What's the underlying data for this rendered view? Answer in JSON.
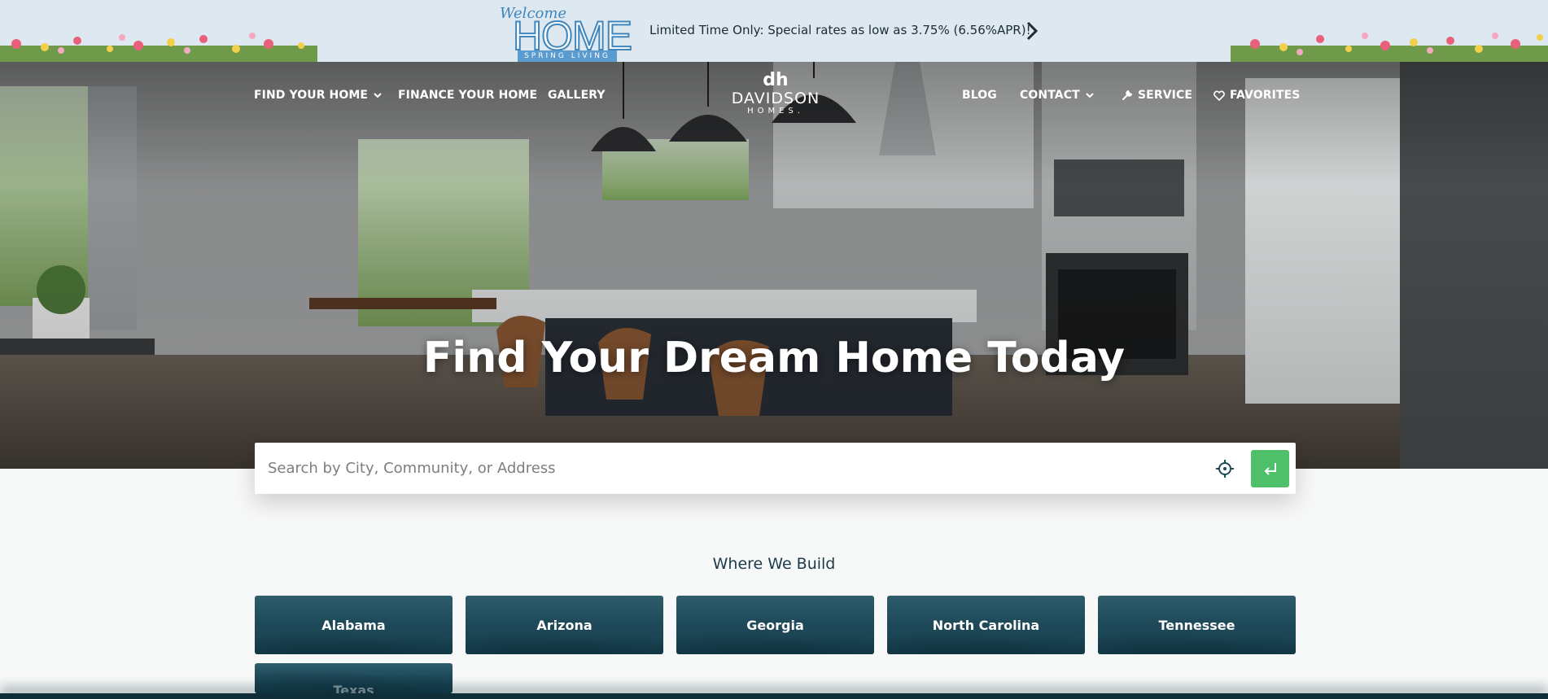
{
  "promo": {
    "logo_script": "Welcome",
    "logo_main": "HOME",
    "logo_sub": "SPRING LIVING",
    "message": "Limited Time Only: Special rates as low as 3.75% (6.56%APR)!",
    "arrow_icon": "chevron-right-icon"
  },
  "nav": {
    "left": [
      {
        "label": "FIND YOUR HOME",
        "icon": "chevron-down-icon"
      },
      {
        "label": "FINANCE YOUR HOME"
      },
      {
        "label": "GALLERY"
      }
    ],
    "brand": {
      "mark": "dh",
      "name": "DAVIDSON",
      "sub": "HOMES."
    },
    "right": [
      {
        "label": "BLOG"
      },
      {
        "label": "CONTACT",
        "icon": "chevron-down-icon"
      },
      {
        "label": "SERVICE",
        "icon": "wrench-icon"
      },
      {
        "label": "FAVORITES",
        "icon": "heart-icon"
      }
    ]
  },
  "hero": {
    "headline": "Find Your Dream Home Today"
  },
  "search": {
    "placeholder": "Search by City, Community, or Address",
    "value": "",
    "locate_icon": "crosshair-icon",
    "submit_icon": "enter-icon",
    "submit_color": "#4fc06a"
  },
  "where_we_build": {
    "title": "Where We Build",
    "states": [
      "Alabama",
      "Arizona",
      "Georgia",
      "North Carolina",
      "Tennessee",
      "Texas"
    ]
  }
}
